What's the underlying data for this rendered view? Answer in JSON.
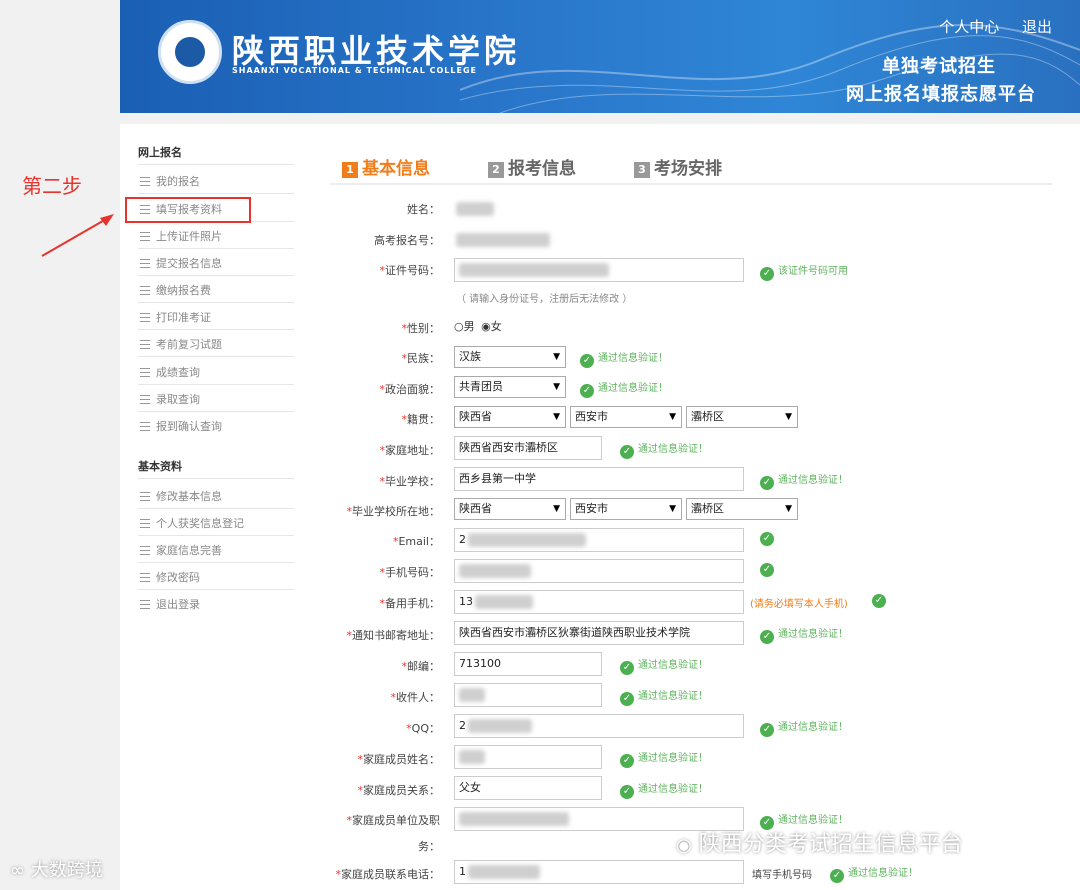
{
  "header": {
    "school_name": "陕西职业技术学院",
    "school_name_en": "SHAANXI VOCATIONAL & TECHNICAL COLLEGE",
    "links": [
      "个人中心",
      "退出"
    ],
    "title_line1": "单独考试招生",
    "title_line2": "网上报名填报志愿平台"
  },
  "annotation": {
    "step_label": "第二步"
  },
  "sidebar": {
    "section1": "网上报名",
    "items1": [
      "我的报名",
      "填写报考资料",
      "上传证件照片",
      "提交报名信息",
      "缴纳报名费",
      "打印准考证",
      "考前复习试题",
      "成绩查询",
      "录取查询",
      "报到确认查询"
    ],
    "section2": "基本资料",
    "items2": [
      "修改基本信息",
      "个人获奖信息登记",
      "家庭信息完善",
      "修改密码",
      "退出登录"
    ]
  },
  "steps": [
    {
      "num": "1",
      "label": "基本信息"
    },
    {
      "num": "2",
      "label": "报考信息"
    },
    {
      "num": "3",
      "label": "考场安排"
    }
  ],
  "form": {
    "name_label": "姓名：",
    "gk_label": "高考报名号：",
    "id_label": "证件号码：",
    "id_ok": "该证件号码可用",
    "id_hint": "（ 请输入身份证号，注册后无法修改 ）",
    "gender_label": "性别：",
    "gender_male": "男",
    "gender_female": "女",
    "ethnic_label": "民族：",
    "ethnic_value": "汉族",
    "political_label": "政治面貌：",
    "political_value": "共青团员",
    "native_label": "籍贯：",
    "province": "陕西省",
    "city": "西安市",
    "district": "灞桥区",
    "home_label": "家庭地址：",
    "home_value": "陕西省西安市灞桥区",
    "school_label": "毕业学校：",
    "school_value": "西乡县第一中学",
    "school_loc_label": "毕业学校所在地：",
    "email_label": "Email：",
    "email_prefix": "2",
    "mobile_label": "手机号码：",
    "backup_label": "备用手机：",
    "backup_prefix": "13",
    "backup_hint": "(请务必填写本人手机)",
    "notice_label": "通知书邮寄地址：",
    "notice_value": "陕西省西安市灞桥区狄寨街道陕西职业技术学院",
    "zip_label": "邮编：",
    "zip_value": "713100",
    "receiver_label": "收件人：",
    "qq_label": "QQ：",
    "qq_prefix": "2",
    "family_name_label": "家庭成员姓名：",
    "family_rel_label": "家庭成员关系：",
    "family_rel_value": "父女",
    "family_unit_label1": "家庭成员单位及职",
    "family_unit_label2": "务：",
    "family_phone_label": "家庭成员联系电话：",
    "family_phone_prefix": "1",
    "family_phone_hint": "填写手机号码",
    "ok_text": "通过信息验证！"
  },
  "watermark": {
    "wechat": "陕西分类考试招生信息平台",
    "brand": "大数跨境"
  },
  "colors": {
    "header_blue": "#1a5fb4",
    "step_active": "#f07d1a",
    "annotation_red": "#e8322e",
    "ok_green": "#4caf50"
  }
}
